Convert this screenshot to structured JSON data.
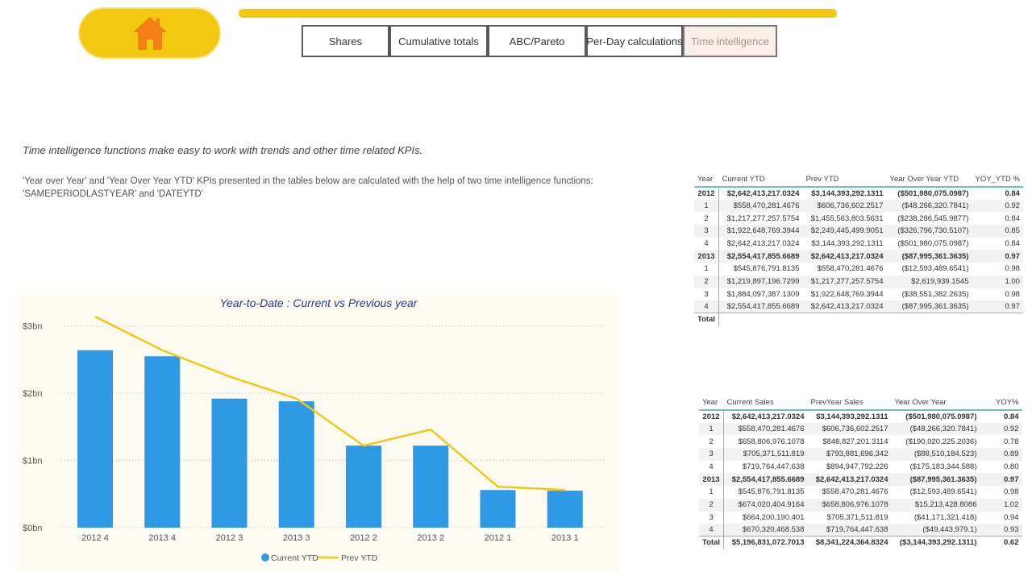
{
  "nav": {
    "home_icon": "home-icon",
    "tabs": [
      {
        "label": "Shares"
      },
      {
        "label": "Cumulative totals"
      },
      {
        "label": "ABC/Pareto"
      },
      {
        "label": "Per-Day calculations"
      },
      {
        "label": "Time intelligence"
      }
    ]
  },
  "intro": "Time intelligence functions make easy to work with trends and other time related KPIs.",
  "description": "'Year over Year' and 'Year Over Year YTD' KPIs presented in the tables below are calculated with the help of two time intelligence functions: 'SAMEPERIODLASTYEAR' and 'DATEYTD'",
  "colors": {
    "accent": "#f2c811",
    "bar": "#2e9ae6",
    "line": "#f2c811",
    "title": "#2a3a8f"
  },
  "chart_data": {
    "type": "bar",
    "title": "Year-to-Date : Current vs Previous year",
    "categories": [
      "2012 4",
      "2013 4",
      "2012 3",
      "2013 3",
      "2012 2",
      "2013 2",
      "2012 1",
      "2013 1"
    ],
    "series": [
      {
        "name": "Current YTD",
        "type": "bar",
        "values": [
          2.64,
          2.55,
          1.92,
          1.88,
          1.22,
          1.22,
          0.56,
          0.55
        ]
      },
      {
        "name": "Prev YTD",
        "type": "line",
        "values": [
          3.14,
          2.64,
          2.25,
          1.92,
          1.22,
          1.46,
          0.61,
          0.56
        ]
      }
    ],
    "y_ticks": [
      "$0bn",
      "$1bn",
      "$2bn",
      "$3bn"
    ],
    "ylim": [
      0,
      3.5
    ],
    "grid": true,
    "legend": "bottom-center"
  },
  "ytd_table": {
    "headers": [
      "Year",
      "Current YTD",
      "Prev YTD",
      "Year Over Year YTD",
      "YOY_YTD %"
    ],
    "rows": [
      {
        "group": true,
        "cells": [
          "2012",
          "$2,642,413,217.0324",
          "$3,144,393,292.1311",
          "($501,980,075.0987)",
          "0.84"
        ]
      },
      {
        "cells": [
          "1",
          "$558,470,281.4676",
          "$606,736,602.2517",
          "($48,266,320.7841)",
          "0.92"
        ]
      },
      {
        "cells": [
          "2",
          "$1,217,277,257.5754",
          "$1,455,563,803.5631",
          "($238,286,545.9877)",
          "0.84"
        ]
      },
      {
        "cells": [
          "3",
          "$1,922,648,769.3944",
          "$2,249,445,499.9051",
          "($326,796,730.5107)",
          "0.85"
        ]
      },
      {
        "cells": [
          "4",
          "$2,642,413,217.0324",
          "$3,144,393,292.1311",
          "($501,980,075.0987)",
          "0.84"
        ]
      },
      {
        "group": true,
        "cells": [
          "2013",
          "$2,554,417,855.6689",
          "$2,642,413,217.0324",
          "($87,995,361.3635)",
          "0.97"
        ]
      },
      {
        "cells": [
          "1",
          "$545,876,791.8135",
          "$558,470,281.4676",
          "($12,593,489.6541)",
          "0.98"
        ]
      },
      {
        "cells": [
          "2",
          "$1,219,897,196.7299",
          "$1,217,277,257.5754",
          "$2,619,939.1545",
          "1.00"
        ]
      },
      {
        "cells": [
          "3",
          "$1,884,097,387.1309",
          "$1,922,648,769.3944",
          "($38,551,382.2635)",
          "0.98"
        ]
      },
      {
        "cells": [
          "4",
          "$2,554,417,855.6689",
          "$2,642,413,217.0324",
          "($87,995,361.3635)",
          "0.97"
        ]
      },
      {
        "total": true,
        "cells": [
          "Total",
          "",
          "",
          "",
          ""
        ]
      }
    ]
  },
  "sales_table": {
    "headers": [
      "Year",
      "Current Sales",
      "PrevYear Sales",
      "Year Over Year",
      "YOY%"
    ],
    "rows": [
      {
        "group": true,
        "cells": [
          "2012",
          "$2,642,413,217.0324",
          "$3,144,393,292.1311",
          "($501,980,075.0987)",
          "0.84"
        ]
      },
      {
        "cells": [
          "1",
          "$558,470,281.4676",
          "$606,736,602.2517",
          "($48,266,320.7841)",
          "0.92"
        ]
      },
      {
        "cells": [
          "2",
          "$658,806,976.1078",
          "$848,827,201.3114",
          "($190,020,225.2036)",
          "0.78"
        ]
      },
      {
        "cells": [
          "3",
          "$705,371,511.819",
          "$793,881,696.342",
          "($88,510,184.523)",
          "0.89"
        ]
      },
      {
        "cells": [
          "4",
          "$719,764,447.638",
          "$894,947,792.226",
          "($175,183,344.588)",
          "0.80"
        ]
      },
      {
        "group": true,
        "cells": [
          "2013",
          "$2,554,417,855.6689",
          "$2,642,413,217.0324",
          "($87,995,361.3635)",
          "0.97"
        ]
      },
      {
        "cells": [
          "1",
          "$545,876,791.8135",
          "$558,470,281.4676",
          "($12,593,489.6541)",
          "0.98"
        ]
      },
      {
        "cells": [
          "2",
          "$674,020,404.9164",
          "$658,806,976.1078",
          "$15,213,428.8086",
          "1.02"
        ]
      },
      {
        "cells": [
          "3",
          "$664,200,190.401",
          "$705,371,511.819",
          "($41,171,321.418)",
          "0.94"
        ]
      },
      {
        "cells": [
          "4",
          "$670,320,468.538",
          "$719,764,447.638",
          "($49,443,979.1)",
          "0.93"
        ]
      },
      {
        "total": true,
        "cells": [
          "Total",
          "$5,196,831,072.7013",
          "$8,341,224,364.8324",
          "($3,144,393,292.1311)",
          "0.62"
        ]
      }
    ]
  }
}
